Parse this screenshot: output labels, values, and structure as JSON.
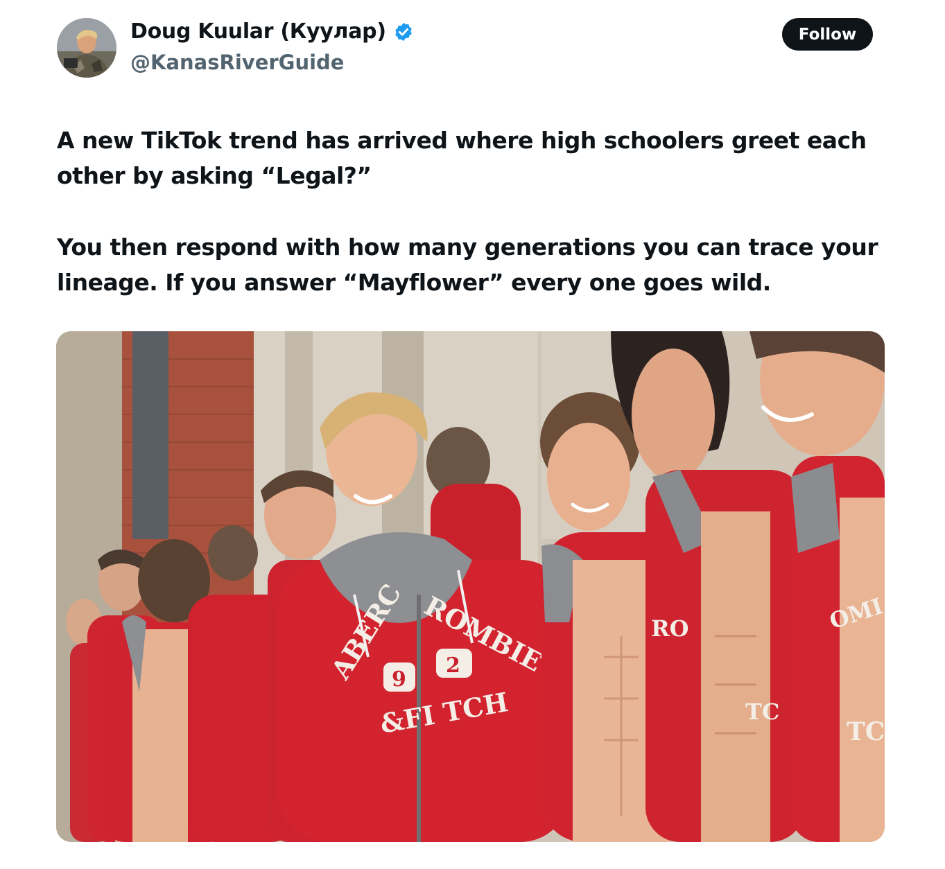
{
  "author": {
    "display_name": "Doug Kuular (Куулар)",
    "handle": "@KanasRiverGuide",
    "verified": true,
    "avatar_icon": "profile-photo"
  },
  "follow_button": {
    "label": "Follow"
  },
  "post": {
    "paragraphs": [
      "A new TikTok trend has arrived where high schoolers greet each other by asking “Legal?”",
      "You then respond with how many generations you can trace your lineage. If you answer “Mayflower” every one goes wild."
    ]
  },
  "media": {
    "kind": "photo",
    "hoodie_print": {
      "arc_left": "ABERC",
      "arc_right": "ROMBIE",
      "number_left": "9",
      "number_right": "2",
      "bottom": "&FI TCH",
      "right_fragment_1": "RO",
      "right_fragment_2": "TC",
      "far_right_fragment_1": "OMI",
      "far_right_fragment_2": "TC"
    },
    "colors": {
      "hoodie_red": "#d21f2b",
      "brick": "#a8523e",
      "stone": "#cfc6b8",
      "skin": "#e9b594"
    }
  },
  "colors": {
    "text": "#0f1419",
    "secondary_text": "#536471",
    "verified_badge": "#1d9bf0",
    "follow_bg": "#0f1419"
  }
}
